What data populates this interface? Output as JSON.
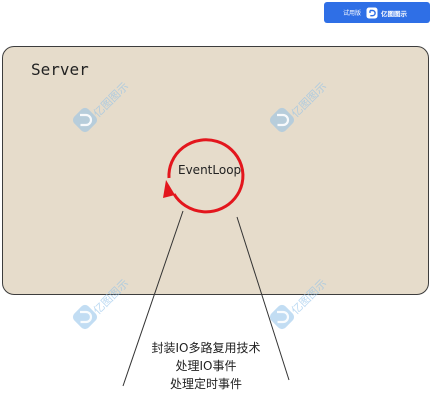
{
  "watermark_badge": {
    "prefix": "试用版",
    "brand": "亿图图示"
  },
  "server": {
    "label": "Server"
  },
  "event_loop": {
    "label": "EventLoop"
  },
  "annotation": {
    "lines": [
      "封装IO多路复用技术",
      "处理IO事件",
      "处理定时事件"
    ]
  },
  "watermark_text": "亿图图示",
  "colors": {
    "box_fill": "#e6dccb",
    "loop_stroke": "#e3161d",
    "badge_bg": "#2f6fe6",
    "watermark": "#8fc1ea"
  }
}
